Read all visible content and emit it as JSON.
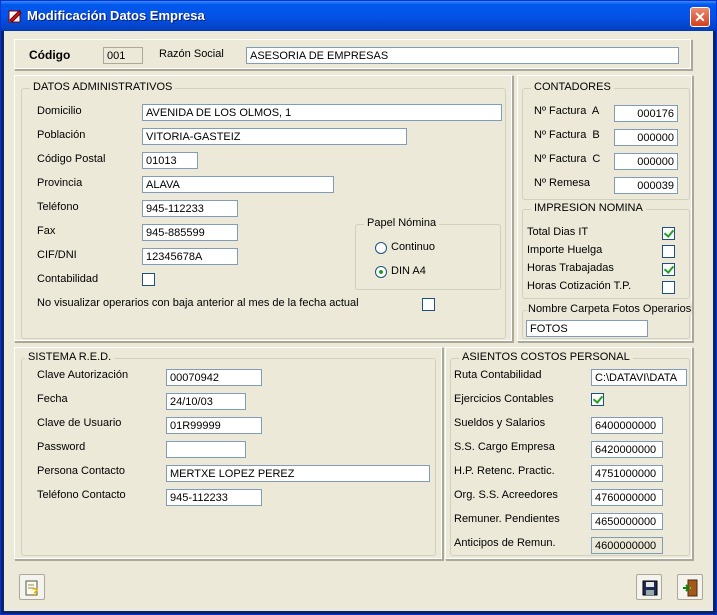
{
  "window": {
    "title": "Modificación Datos Empresa"
  },
  "header": {
    "codigo_label": "Código",
    "codigo_value": "001",
    "razon_label": "Razón Social",
    "razon_value": "ASESORIA DE EMPRESAS"
  },
  "admin": {
    "title": "DATOS ADMINISTRATIVOS",
    "domicilio_label": "Domicilio",
    "domicilio_value": "AVENIDA DE LOS OLMOS, 1",
    "poblacion_label": "Población",
    "poblacion_value": "VITORIA-GASTEIZ",
    "cp_label": "Código Postal",
    "cp_value": "01013",
    "provincia_label": "Provincia",
    "provincia_value": "ALAVA",
    "telefono_label": "Teléfono",
    "telefono_value": "945-112233",
    "fax_label": "Fax",
    "fax_value": "945-885599",
    "cif_label": "CIF/DNI",
    "cif_value": "12345678A",
    "contabilidad_label": "Contabilidad",
    "contabilidad_checked": false,
    "novisualizar_label": "No visualizar operarios con baja anterior al mes de la fecha actual",
    "novisualizar_checked": false,
    "papel": {
      "title": "Papel Nómina",
      "continuo_label": "Continuo",
      "dina4_label": "DIN A4",
      "selected": "DIN A4"
    }
  },
  "contadores": {
    "title": "CONTADORES",
    "factura_a_label": "Nº Factura  A",
    "factura_a_value": "000176",
    "factura_b_label": "Nº Factura  B",
    "factura_b_value": "000000",
    "factura_c_label": "Nº Factura  C",
    "factura_c_value": "000000",
    "remesa_label": "Nº Remesa",
    "remesa_value": "000039"
  },
  "impresion": {
    "title": "IMPRESION NOMINA",
    "items": [
      {
        "label": "Total Dias IT",
        "checked": true
      },
      {
        "label": "Importe Huelga",
        "checked": false
      },
      {
        "label": "Horas Trabajadas",
        "checked": true
      },
      {
        "label": "Horas Cotización T.P.",
        "checked": false
      }
    ]
  },
  "fotos": {
    "title": "Nombre Carpeta Fotos Operarios",
    "value": "FOTOS"
  },
  "red": {
    "title": "SISTEMA R.E.D.",
    "clave_label": "Clave Autorización",
    "clave_value": "00070942",
    "fecha_label": "Fecha",
    "fecha_value": "24/10/03",
    "usuario_label": "Clave de Usuario",
    "usuario_value": "01R99999",
    "password_label": "Password",
    "password_value": "",
    "persona_label": "Persona Contacto",
    "persona_value": "MERTXE LOPEZ PEREZ",
    "tel_label": "Teléfono Contacto",
    "tel_value": "945-112233"
  },
  "asientos": {
    "title": "ASIENTOS COSTOS PERSONAL",
    "ruta_label": "Ruta Contabilidad",
    "ruta_value": "C:\\DATAVI\\DATA",
    "ejercicios_label": "Ejercicios Contables",
    "ejercicios_checked": true,
    "sueldos_label": "Sueldos y Salarios",
    "sueldos_value": "6400000000",
    "ss_label": "S.S. Cargo Empresa",
    "ss_value": "6420000000",
    "hp_label": "H.P. Retenc. Practic.",
    "hp_value": "4751000000",
    "org_label": "Org. S.S. Acreedores",
    "org_value": "4760000000",
    "remuner_label": "Remuner. Pendientes",
    "remuner_value": "4650000000",
    "anticipos_label": "Anticipos de Remun.",
    "anticipos_value": "4600000000"
  },
  "icons": {
    "help": "help-icon",
    "save": "floppy-disk-icon",
    "exit": "exit-door-icon"
  }
}
